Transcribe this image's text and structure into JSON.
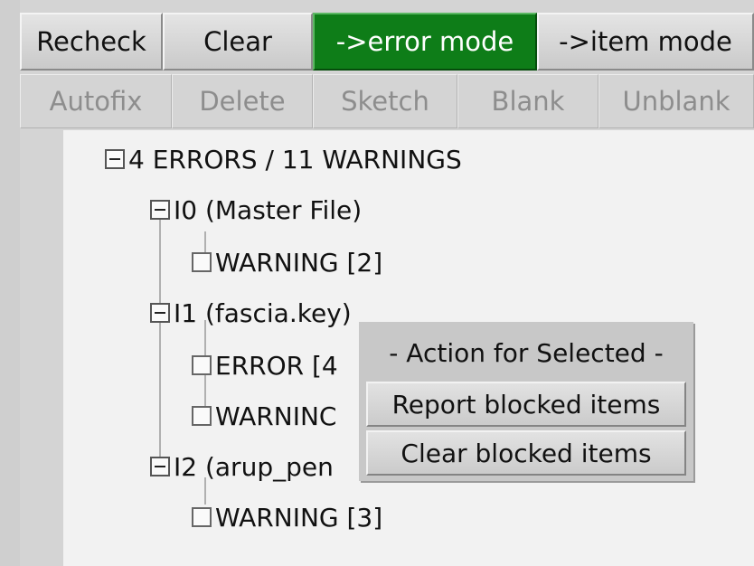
{
  "toolbar": {
    "row1": [
      "Recheck",
      "Clear",
      "->error mode",
      "->item mode"
    ],
    "row2": [
      "Autofix",
      "Delete",
      "Sketch",
      "Blank",
      "Unblank"
    ]
  },
  "tree": {
    "root": "4 ERRORS / 11 WARNINGS",
    "file0": "I0 (Master File)",
    "file0_warning": "WARNING [2]",
    "file1": "I1 (fascia.key)",
    "file1_error": "ERROR [4",
    "file1_warning": "WARNINC",
    "file2": "I2 (arup_pen",
    "file2_warning": "WARNING [3]"
  },
  "context_menu": {
    "title": "- Action for Selected -",
    "items": [
      "Report blocked items",
      "Clear blocked items"
    ]
  },
  "colors": {
    "active_button": "#0e7d18",
    "background": "#d4d4d4",
    "disabled_text": "#8d8d8d"
  }
}
